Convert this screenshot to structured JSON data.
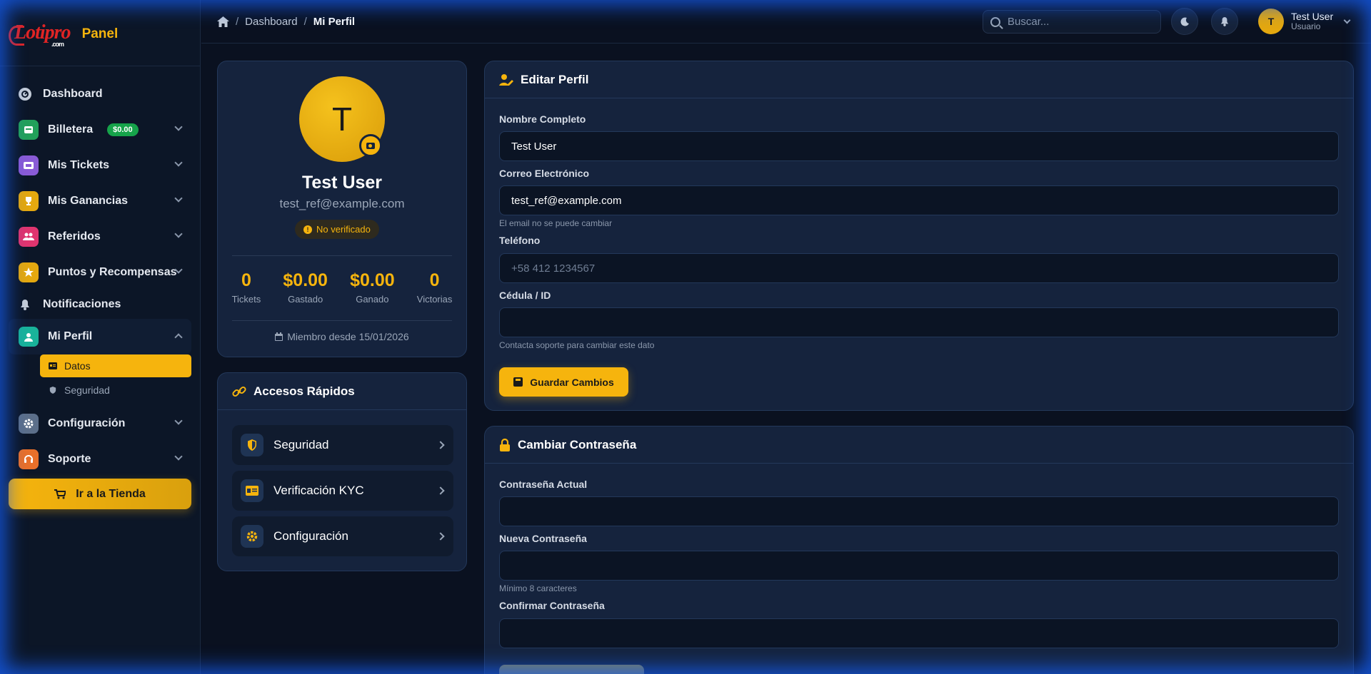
{
  "brand": {
    "logo_text": "Lotipro",
    "logo_suffix": ".com",
    "panel_label": "Panel"
  },
  "sidebar": {
    "items": [
      {
        "label": "Dashboard"
      },
      {
        "label": "Billetera",
        "badge": "$0.00"
      },
      {
        "label": "Mis Tickets"
      },
      {
        "label": "Mis Ganancias"
      },
      {
        "label": "Referidos"
      },
      {
        "label": "Puntos y Recompensas"
      },
      {
        "label": "Notificaciones"
      },
      {
        "label": "Mi Perfil",
        "sub": [
          {
            "label": "Datos"
          },
          {
            "label": "Seguridad"
          }
        ]
      },
      {
        "label": "Configuración"
      },
      {
        "label": "Soporte"
      }
    ],
    "store_button": "Ir a la Tienda"
  },
  "header": {
    "breadcrumb": [
      "Dashboard",
      "Mi Perfil"
    ],
    "search_placeholder": "Buscar...",
    "user_name": "Test User",
    "user_role": "Usuario",
    "user_initial": "T"
  },
  "profile": {
    "initial": "T",
    "name": "Test User",
    "email": "test_ref@example.com",
    "status": "No verificado",
    "stats": [
      {
        "value": "0",
        "label": "Tickets"
      },
      {
        "value": "$0.00",
        "label": "Gastado"
      },
      {
        "value": "$0.00",
        "label": "Ganado"
      },
      {
        "value": "0",
        "label": "Victorias"
      }
    ],
    "member_since": "Miembro desde 15/01/2026"
  },
  "quick": {
    "title": "Accesos Rápidos",
    "items": [
      {
        "label": "Seguridad"
      },
      {
        "label": "Verificación KYC"
      },
      {
        "label": "Configuración"
      }
    ]
  },
  "edit": {
    "title": "Editar Perfil",
    "name_label": "Nombre Completo",
    "name_value": "Test User",
    "email_label": "Correo Electrónico",
    "email_value": "test_ref@example.com",
    "email_hint": "El email no se puede cambiar",
    "phone_label": "Teléfono",
    "phone_placeholder": "+58 412 1234567",
    "id_label": "Cédula / ID",
    "id_value": "",
    "id_hint": "Contacta soporte para cambiar este dato",
    "save_label": "Guardar Cambios"
  },
  "password": {
    "title": "Cambiar Contraseña",
    "current_label": "Contraseña Actual",
    "new_label": "Nueva Contraseña",
    "new_hint": "Mínimo 8 caracteres",
    "confirm_label": "Confirmar Contraseña"
  },
  "colors": {
    "accent": "#f6b40d",
    "background": "#0a1120",
    "card": "#15233d",
    "glow": "#155cec"
  }
}
